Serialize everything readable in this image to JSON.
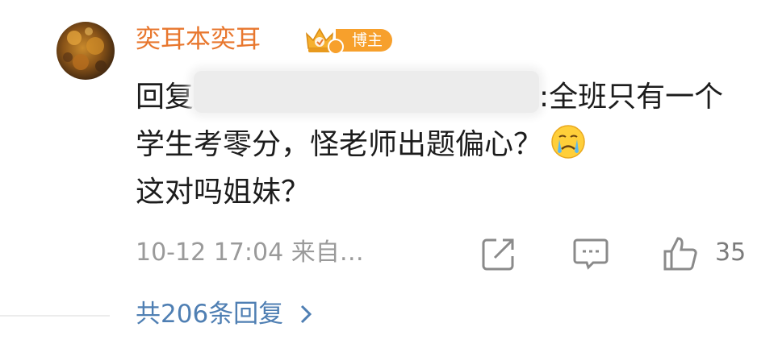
{
  "comment": {
    "username": "奕耳本奕耳",
    "badge_label": "博主",
    "reply_prefix": "回复",
    "reply_text": ":全班只有一个学生考零分，怪老师出题偏心？",
    "reply_text_tail": "这对吗姐妹？",
    "emoji_icon": "crying-face-emoji",
    "timestamp": "10-12 17:04",
    "source_label": "来自…",
    "like_count": "35",
    "replies_link": "共206条回复"
  },
  "colors": {
    "username": "#e8772e",
    "badge": "#f7a02c",
    "link": "#4f7fb3",
    "meta": "#9a9a9a"
  }
}
